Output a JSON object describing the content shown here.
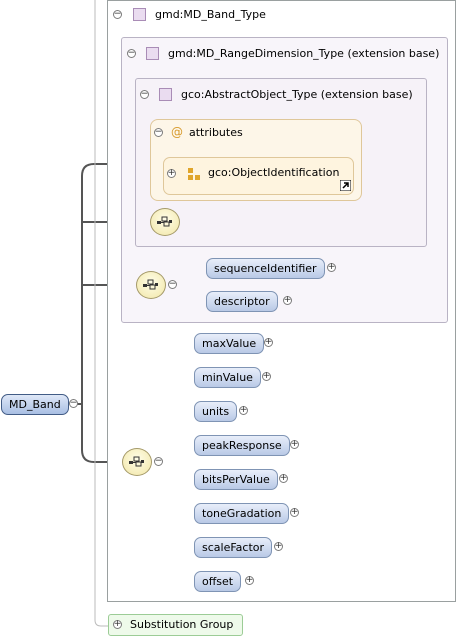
{
  "root": {
    "label": "MD_Band"
  },
  "band_type": {
    "label": "gmd:MD_Band_Type"
  },
  "range_dimension": {
    "label": "gmd:MD_RangeDimension_Type (extension base)"
  },
  "abstract_object": {
    "label": "gco:AbstractObject_Type (extension base)"
  },
  "attributes": {
    "label": "attributes",
    "item_label": "gco:ObjectIdentification"
  },
  "range_elements": [
    "sequenceIdentifier",
    "descriptor"
  ],
  "band_elements": [
    "maxValue",
    "minValue",
    "units",
    "peakResponse",
    "bitsPerValue",
    "toneGradation",
    "scaleFactor",
    "offset"
  ],
  "substitution": {
    "label": "Substitution Group"
  },
  "colors": {
    "connector": "#4a4a4a",
    "element_fill": "#c7d5ee",
    "attribute_fill": "#fdf6e8",
    "type_fill": "#f8f5fa"
  },
  "icons": {
    "toggle_minus": "−",
    "toggle_plus": "+"
  }
}
